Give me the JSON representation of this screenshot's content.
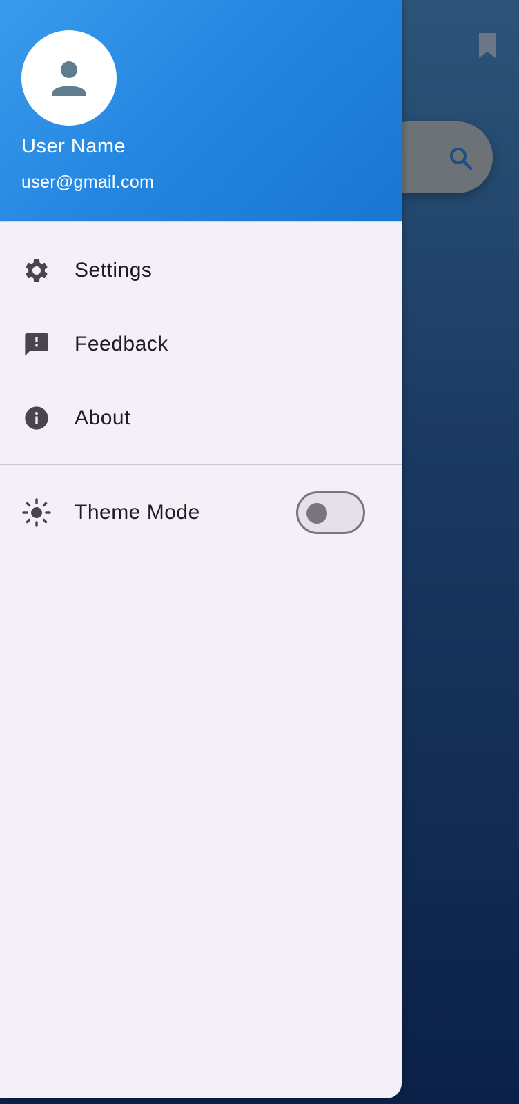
{
  "drawer": {
    "header": {
      "user_name": "User Name",
      "user_email": "user@gmail.com",
      "avatar_icon": "person-icon",
      "gradient_colors": [
        "#3a9bec",
        "#1976d2"
      ]
    },
    "menu_items": [
      {
        "label": "Settings",
        "icon": "gear-icon"
      },
      {
        "label": "Feedback",
        "icon": "feedback-icon"
      },
      {
        "label": "About",
        "icon": "info-icon"
      }
    ],
    "theme_row": {
      "label": "Theme Mode",
      "icon": "sun-icon",
      "toggle_on": false
    }
  },
  "background": {
    "bookmark_icon": "bookmark-icon",
    "search_icon": "search-icon"
  },
  "colors": {
    "drawer_bg": "#f4f0f7",
    "text": "#1f1b24",
    "icon": "#49454f"
  }
}
